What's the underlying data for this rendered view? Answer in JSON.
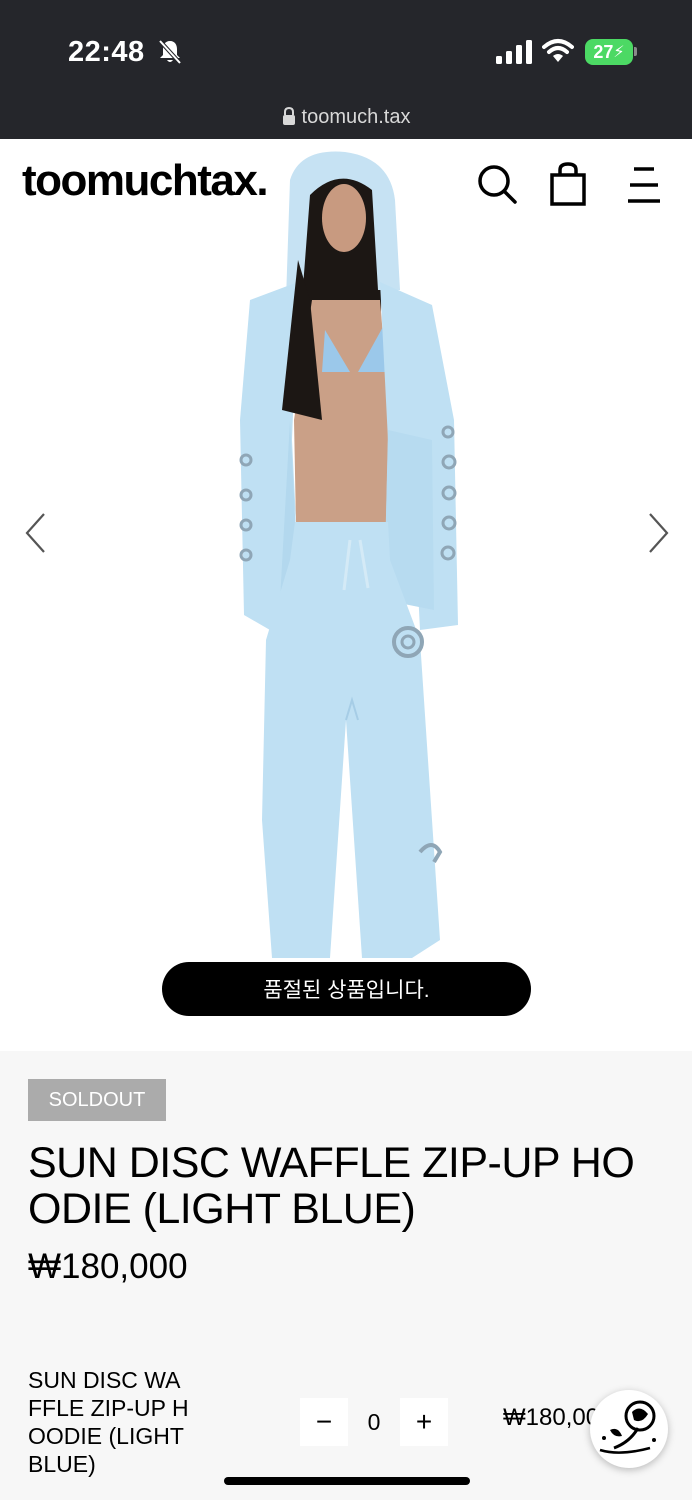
{
  "status_bar": {
    "time": "22:48",
    "battery": "27",
    "url": "toomuch.tax"
  },
  "header": {
    "logo": "toomuchtax."
  },
  "product_image": {
    "alt": "model wearing light blue hoodie and pants",
    "soldout_toast": "품절된 상품입니다."
  },
  "product": {
    "badge": "SOLDOUT",
    "title": "SUN DISC WAFFLE ZIP-UP HO ODIE (LIGHT BLUE)",
    "price": "₩180,000"
  },
  "option": {
    "name": "SUN DISC WA FFLE ZIP-UP H OODIE (LIGHT BLUE)",
    "quantity": "0",
    "minus": "−",
    "plus": "+",
    "price": "₩180,000"
  },
  "colors": {
    "status_bar_bg": "#25262b",
    "battery": "#4cd964",
    "garment": "#bfe0f3",
    "info_bg": "#f7f7f7",
    "badge_bg": "#ababab"
  },
  "icons": [
    "bell-slash-icon",
    "signal-icon",
    "wifi-icon",
    "battery-icon",
    "lock-icon",
    "search-icon",
    "shopping-bag-icon",
    "menu-icon",
    "chevron-left-icon",
    "chevron-right-icon",
    "rose-chat-icon"
  ]
}
